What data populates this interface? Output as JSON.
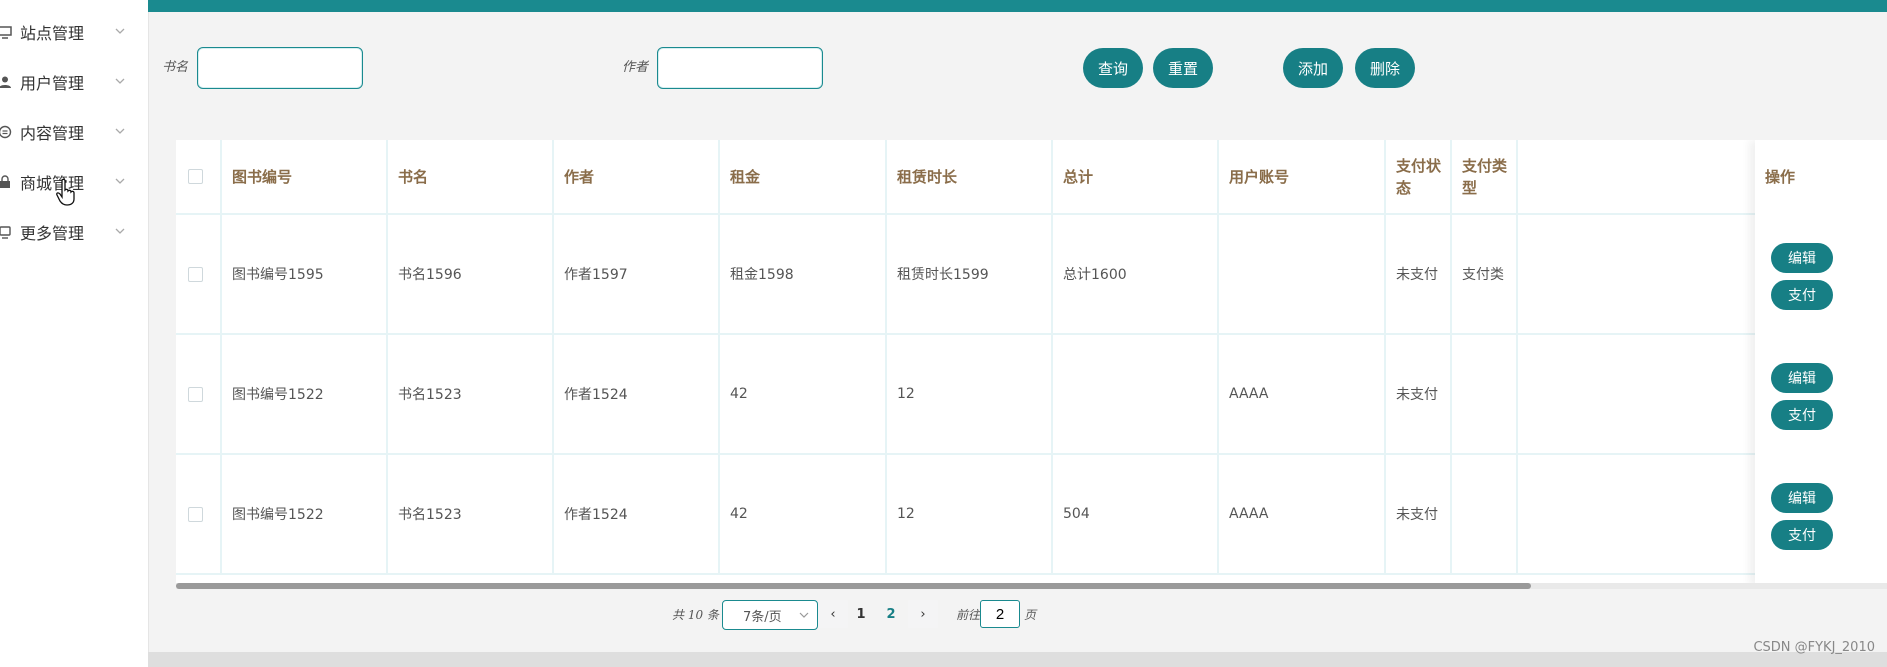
{
  "sidebar": {
    "items": [
      {
        "label": "站点管理",
        "icon": "monitor-icon"
      },
      {
        "label": "用户管理",
        "icon": "user-icon"
      },
      {
        "label": "内容管理",
        "icon": "message-icon"
      },
      {
        "label": "商城管理",
        "icon": "lock-icon"
      },
      {
        "label": "更多管理",
        "icon": "window-icon"
      }
    ]
  },
  "search": {
    "title_label": "书名",
    "title_value": "",
    "author_label": "作者",
    "author_value": ""
  },
  "toolbar": {
    "query_label": "查询",
    "reset_label": "重置",
    "add_label": "添加",
    "delete_label": "删除"
  },
  "table": {
    "headers": [
      "图书编号",
      "书名",
      "作者",
      "租金",
      "租赁时长",
      "总计",
      "用户账号",
      "支付状态",
      "支付类型"
    ],
    "action_header": "操作",
    "rows": [
      [
        "图书编号1595",
        "书名1596",
        "作者1597",
        "租金1598",
        "租赁时长1599",
        "总计1600",
        "",
        "未支付",
        "支付类"
      ],
      [
        "图书编号1522",
        "书名1523",
        "作者1524",
        "42",
        "12",
        "",
        "AAAA",
        "未支付",
        ""
      ],
      [
        "图书编号1522",
        "书名1523",
        "作者1524",
        "42",
        "12",
        "504",
        "AAAA",
        "未支付",
        ""
      ]
    ],
    "edit_label": "编辑",
    "pay_label": "支付"
  },
  "pagination": {
    "total_text": "共 10 条",
    "page_size": "7条/页",
    "prev": "‹",
    "next": "›",
    "pages": [
      "1",
      "2"
    ],
    "current_page": "2",
    "goto_prefix": "前往",
    "goto_value": "2",
    "goto_suffix": "页"
  },
  "watermark": "CSDN @FYKJ_2010",
  "colors": {
    "accent": "#177f85",
    "topbar": "#1a8a8f",
    "header_text": "#8a6d4a"
  }
}
